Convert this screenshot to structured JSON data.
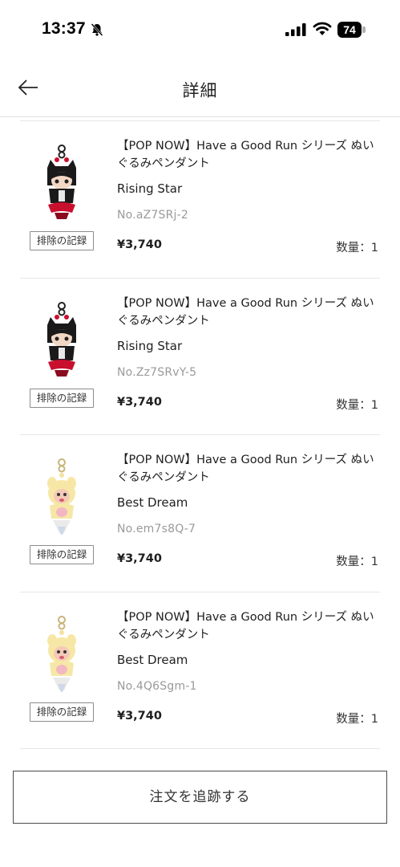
{
  "status_bar": {
    "time": "13:37",
    "battery": "74",
    "icons": [
      "bell-slash-icon",
      "signal-icon",
      "wifi-icon",
      "battery-icon"
    ]
  },
  "header": {
    "title": "詳細",
    "back_icon": "arrow-left-icon"
  },
  "items": [
    {
      "name": "【POP NOW】Have a Good Run シリーズ ぬいぐるみペンダント",
      "variant": "Rising Star",
      "code": "No.aZ7SRj-2",
      "price": "¥3,740",
      "quantity": "数量：1",
      "exclude_label": "排除の記録",
      "image": "rising-star-pendant"
    },
    {
      "name": "【POP NOW】Have a Good Run シリーズ ぬいぐるみペンダント",
      "variant": "Rising Star",
      "code": "No.Zz7SRvY-5",
      "price": "¥3,740",
      "quantity": "数量：1",
      "exclude_label": "排除の記録",
      "image": "rising-star-pendant"
    },
    {
      "name": "【POP NOW】Have a Good Run シリーズ ぬいぐるみペンダント",
      "variant": "Best Dream",
      "code": "No.em7s8Q-7",
      "price": "¥3,740",
      "quantity": "数量：1",
      "exclude_label": "排除の記録",
      "image": "best-dream-pendant"
    },
    {
      "name": "【POP NOW】Have a Good Run シリーズ ぬいぐるみペンダント",
      "variant": "Best Dream",
      "code": "No.4Q6Sgm-1",
      "price": "¥3,740",
      "quantity": "数量：1",
      "exclude_label": "排除の記録",
      "image": "best-dream-pendant"
    }
  ],
  "footer": {
    "track_button": "注文を追跡する"
  },
  "colors": {
    "text": "#1e1e1e",
    "muted": "#9a9a9a",
    "divider": "#e6e6e6",
    "rising_star_red": "#c8102e",
    "best_dream_yellow": "#f7e7a6"
  }
}
